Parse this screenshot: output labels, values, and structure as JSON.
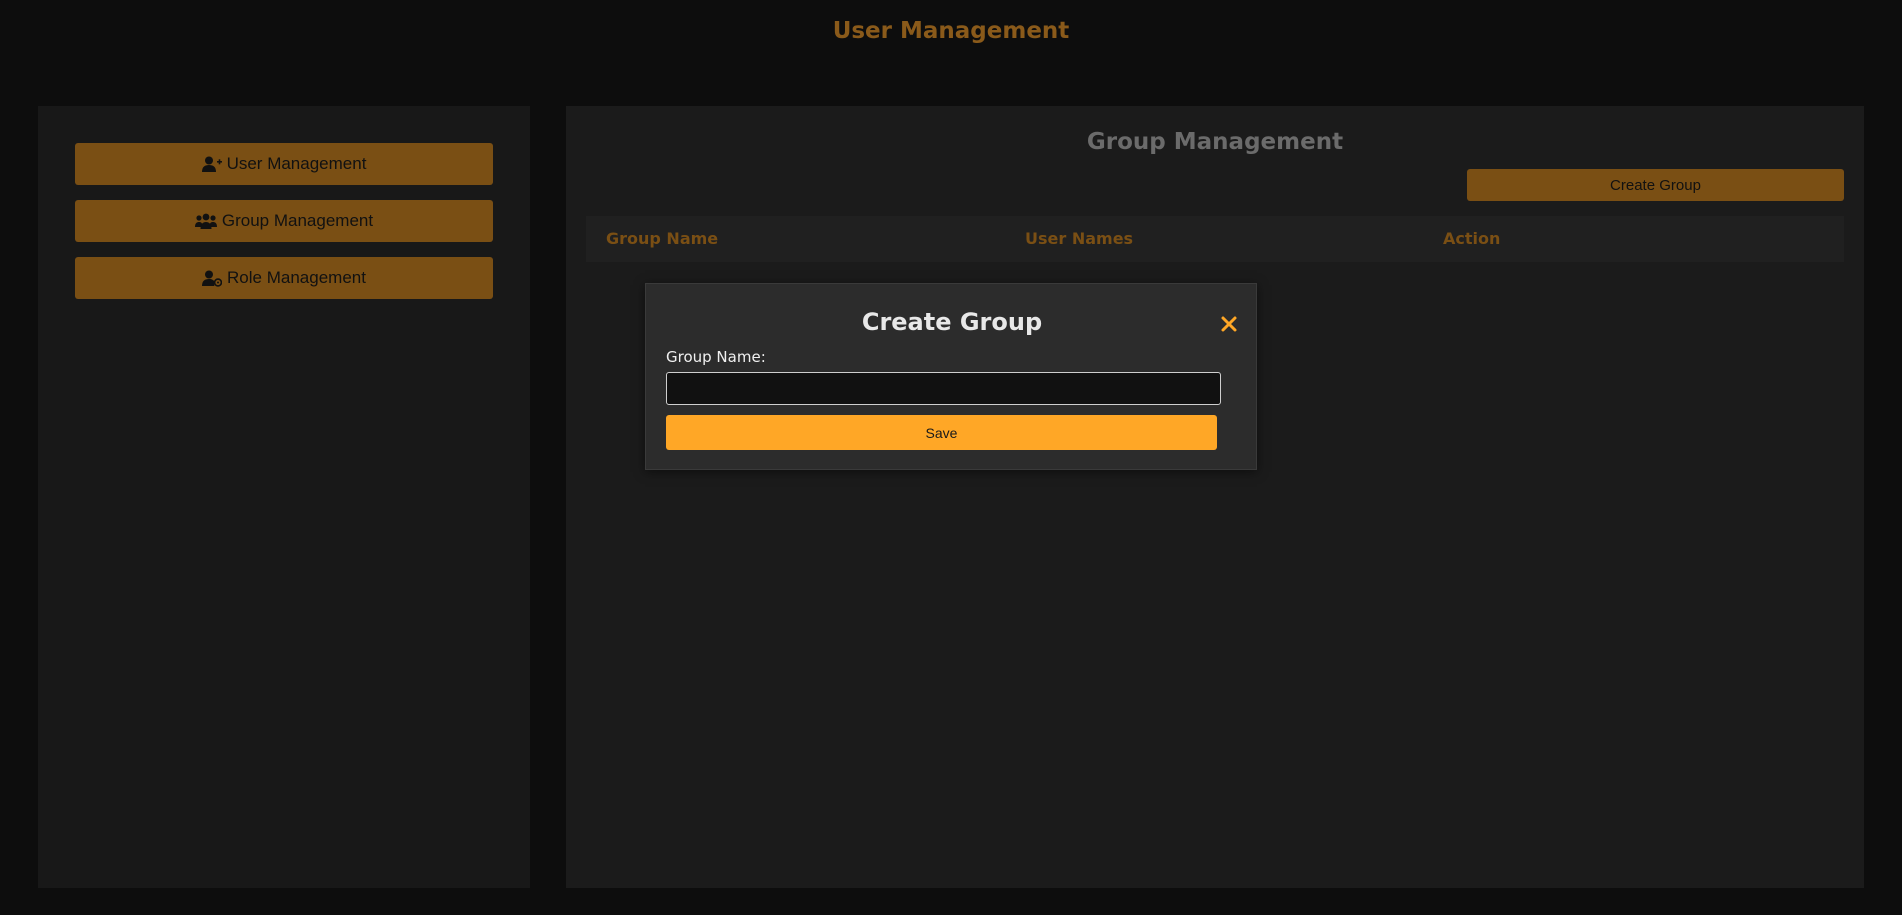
{
  "header": {
    "title": "User Management"
  },
  "sidebar": {
    "items": [
      {
        "label": "User Management",
        "icon": "user-plus-icon"
      },
      {
        "label": "Group Management",
        "icon": "users-icon"
      },
      {
        "label": "Role Management",
        "icon": "user-gear-icon"
      }
    ]
  },
  "main": {
    "title": "Group Management",
    "create_button_label": "Create Group",
    "table": {
      "columns": [
        "Group Name",
        "User Names",
        "Action"
      ],
      "rows": []
    }
  },
  "modal": {
    "title": "Create Group",
    "close_icon": "close-icon",
    "field_label": "Group Name:",
    "field_value": "",
    "save_label": "Save"
  },
  "colors": {
    "background": "#0d0d0d",
    "panel": "#1b1b1b",
    "accent": "#7a4f14",
    "save_accent": "#ffa726",
    "close_accent": "#ffa726"
  }
}
